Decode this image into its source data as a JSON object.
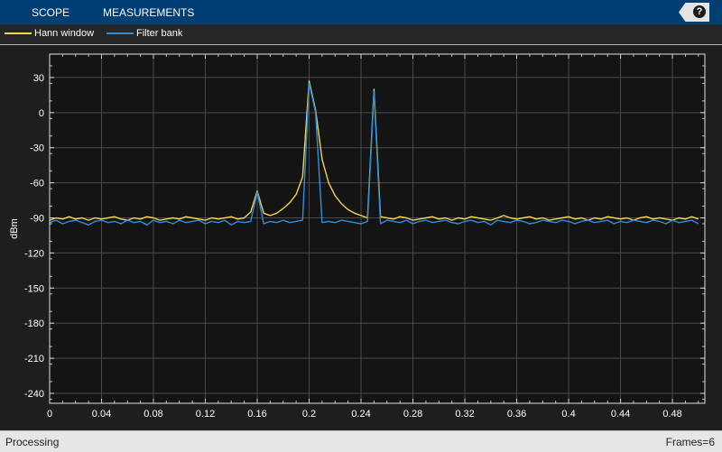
{
  "toolbar": {
    "tabs": [
      "SCOPE",
      "MEASUREMENTS"
    ],
    "help_label": "?"
  },
  "status": {
    "left": "Processing",
    "right": "Frames=6"
  },
  "colors": {
    "hann": "#f1d54a",
    "filter": "#2d8fdc",
    "plot_bg": "#141414",
    "grid": "#4a4a4a"
  },
  "chart_data": {
    "type": "line",
    "title": "",
    "xlabel": "",
    "ylabel": "dBm",
    "xlim": [
      0,
      0.505
    ],
    "ylim": [
      -248.5,
      50
    ],
    "grid": true,
    "legend_position": "top-left",
    "x_ticks": [
      0,
      0.04,
      0.08,
      0.12,
      0.16,
      0.2,
      0.24,
      0.28,
      0.32,
      0.36,
      0.4,
      0.44,
      0.48
    ],
    "x_tick_labels": [
      "0",
      "0.04",
      "0.08",
      "0.12",
      "0.16",
      "0.2",
      "0.24",
      "0.28",
      "0.32",
      "0.36",
      "0.4",
      "0.44",
      "0.48"
    ],
    "y_ticks": [
      30,
      0,
      -30,
      -60,
      -90,
      -120,
      -150,
      -180,
      -210,
      -240
    ],
    "y_tick_labels": [
      "30",
      "0",
      "-30",
      "-60",
      "-90",
      "-120",
      "-150",
      "-180",
      "-210",
      "-240"
    ],
    "x_start": 0,
    "x_step": 0.005,
    "series": [
      {
        "name": "Hann window",
        "color": "#f1d54a",
        "values": [
          -92,
          -90,
          -91,
          -89,
          -91,
          -90,
          -92,
          -90,
          -91,
          -90,
          -89,
          -91,
          -92,
          -90,
          -91,
          -89,
          -90,
          -92,
          -91,
          -90,
          -91,
          -89,
          -90,
          -91,
          -92,
          -90,
          -91,
          -90,
          -89,
          -91,
          -90,
          -85,
          -67,
          -86,
          -88,
          -86,
          -82,
          -77,
          -70,
          -55,
          27,
          2,
          -40,
          -60,
          -71,
          -78,
          -83,
          -86,
          -88,
          -90,
          20,
          -89,
          -90,
          -91,
          -89,
          -90,
          -92,
          -91,
          -90,
          -89,
          -91,
          -90,
          -92,
          -90,
          -91,
          -89,
          -90,
          -91,
          -92,
          -90,
          -88,
          -90,
          -91,
          -90,
          -89,
          -91,
          -90,
          -92,
          -91,
          -90,
          -89,
          -91,
          -90,
          -92,
          -90,
          -91,
          -89,
          -90,
          -91,
          -90,
          -92,
          -90,
          -89,
          -91,
          -90,
          -91,
          -92,
          -90,
          -91,
          -89,
          -91
        ]
      },
      {
        "name": "Filter bank",
        "color": "#2d8fdc",
        "values": [
          -94,
          -92,
          -95,
          -93,
          -92,
          -94,
          -96,
          -93,
          -92,
          -94,
          -93,
          -95,
          -92,
          -94,
          -93,
          -96,
          -92,
          -94,
          -93,
          -95,
          -92,
          -94,
          -93,
          -92,
          -95,
          -93,
          -94,
          -92,
          -96,
          -93,
          -94,
          -93,
          -68,
          -95,
          -93,
          -94,
          -92,
          -94,
          -93,
          -92,
          25,
          0,
          -94,
          -93,
          -94,
          -92,
          -93,
          -94,
          -95,
          -93,
          18,
          -95,
          -92,
          -93,
          -94,
          -92,
          -95,
          -93,
          -92,
          -94,
          -93,
          -92,
          -94,
          -95,
          -93,
          -92,
          -94,
          -93,
          -96,
          -92,
          -93,
          -94,
          -92,
          -93,
          -95,
          -94,
          -92,
          -93,
          -94,
          -92,
          -93,
          -95,
          -93,
          -92,
          -94,
          -93,
          -92,
          -95,
          -93,
          -94,
          -92,
          -93,
          -94,
          -92,
          -93,
          -95,
          -92,
          -94,
          -93,
          -92,
          -95
        ]
      }
    ]
  }
}
